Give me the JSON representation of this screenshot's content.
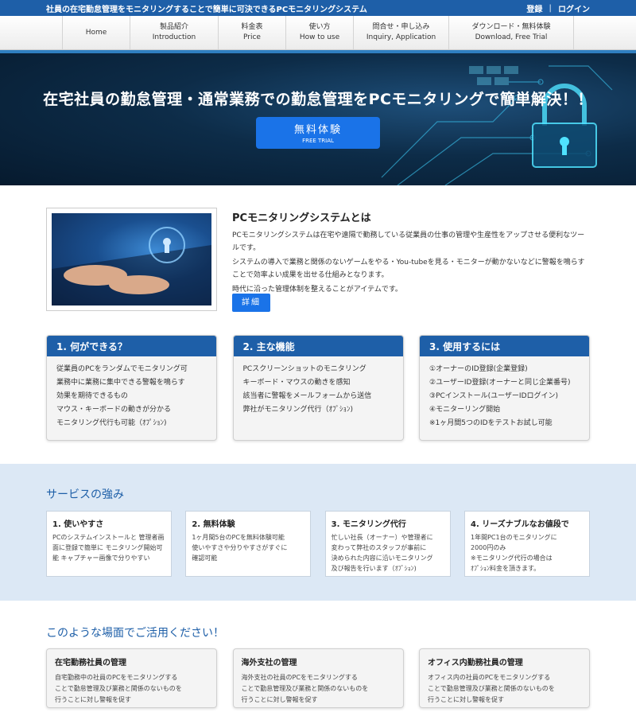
{
  "topbar": {
    "tagline": "社員の在宅勤怠管理をモニタリングすることで簡単に可決できるPCモニタリングシステム",
    "login_register": "登録",
    "login": "ログイン"
  },
  "nav": [
    {
      "ja": "Home",
      "en": ""
    },
    {
      "ja": "製品紹介",
      "en": "Introduction"
    },
    {
      "ja": "料金表",
      "en": "Price"
    },
    {
      "ja": "使い方",
      "en": "How to use"
    },
    {
      "ja": "問合せ・申し込み",
      "en": "Inquiry, Application"
    },
    {
      "ja": "ダウンロード・無料体験",
      "en": "Download, Free Trial"
    }
  ],
  "hero": {
    "headline": "在宅社員の勤怠管理・通常業務での勤怠管理をPCモニタリングで簡単解決！！",
    "cta_ja": "無料体験",
    "cta_en": "FREE TRIAL"
  },
  "about": {
    "title": "PCモニタリングシステムとは",
    "p1": "PCモニタリングシステムは在宅や遠隔で勤務している従業員の仕事の管理や生産性をアップさせる便利なツールです。",
    "p2": "システムの導入で業務と関係のないゲームをやる・You-tubeを見る・モニターが動かないなどに警報を鳴らすことで効率よい成果を出せる仕組みとなります。",
    "p3": "時代に沿った管理体制を整えることがアイテムです。",
    "detail_button": "詳細"
  },
  "features": [
    {
      "title": "1. 何ができる？",
      "items": [
        "従業員のPCをランダムでモニタリング可",
        "業務中に業務に集中できる警報を鳴らす",
        "効果を期待できるもの",
        "マウス・キーボードの動きが分かる",
        "モニタリング代行も可能（ｵﾌﾟｼｮﾝ)"
      ]
    },
    {
      "title": "2. 主な機能",
      "items": [
        "PCスクリーンショットのモニタリング",
        "キーボード・マウスの動きを感知",
        "該当者に警報をメールフォームから送信",
        "弊社がモニタリング代行（ｵﾌﾟｼｮﾝ)"
      ]
    },
    {
      "title": "3. 使用するには",
      "items": [
        "①オーナーのID登録(企業登録)",
        "②ユーザーID登録(オーナーと同じ企業番号)",
        "③PCインストール(ユーザーIDログイン)",
        "④モニターリング開始",
        "※1ヶ月間5つのIDをテストお試し可能"
      ]
    }
  ],
  "strengths": {
    "title": "サービスの強み",
    "cards": [
      {
        "title": "1. 使いやすさ",
        "lines": [
          "PCのシステムインストールと 管理者画",
          "面に登録で簡単に モニタリング開始可",
          "能 キャプチャー画像で分りやすい"
        ]
      },
      {
        "title": "2. 無料体験",
        "lines": [
          "1ヶ月間5台のPCを無料体験可能",
          "使いやすさや分りやすさがすぐに",
          "確認可能"
        ]
      },
      {
        "title": "3. モニタリング代行",
        "lines": [
          "忙しい社長（オーナー）や管理者に",
          "変わって弊社のスタッフが事前に",
          "決められた内容に沿いモニタリング",
          "及び報告を行います（ｵﾌﾟｼｮﾝ)"
        ]
      },
      {
        "title": "4. リーズナブルなお値段で",
        "lines": [
          "1年間PC1台のモニタリングに",
          "2000円のみ",
          "※モニタリング代行の場合は",
          "ｵﾌﾟｼｮﾝ料金を頂きます。"
        ]
      }
    ]
  },
  "usage": {
    "title": "このような場面でご活用ください！",
    "cards": [
      {
        "title": "在宅勤務社員の管理",
        "lines": [
          "自宅勤務中の社員のPCをモニタリングする",
          "ことで勤怠管理及び業務と関係のないものを",
          "行うことに対し警報を促す"
        ]
      },
      {
        "title": "海外支社の管理",
        "lines": [
          "海外支社の社員のPCをモニタリングする",
          "ことで勤怠管理及び業務と関係のないものを",
          "行うことに対し警報を促す"
        ]
      },
      {
        "title": "オフィス内勤務社員の管理",
        "lines": [
          "オフィス内の社員のPCをモニタリングする",
          "ことで勤怠管理及び業務と関係のないものを",
          "行うことに対し警報を促す"
        ]
      }
    ]
  }
}
